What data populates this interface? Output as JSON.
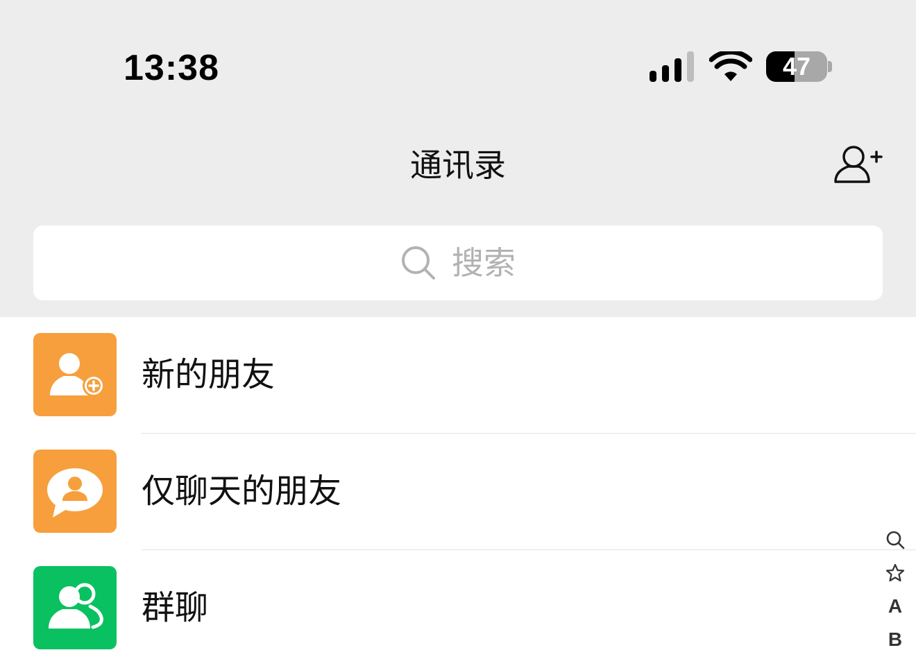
{
  "status_bar": {
    "time": "13:38",
    "battery_level": "47",
    "battery_fraction": 0.47,
    "signal_icon": "cellular-signal-icon",
    "wifi_icon": "wifi-icon"
  },
  "header": {
    "title": "通讯录",
    "add_contact_icon": "add-contact-icon"
  },
  "search": {
    "placeholder": "搜索",
    "icon": "search-icon"
  },
  "contacts_menu": [
    {
      "label": "新的朋友",
      "icon": "new-friend-icon",
      "color": "#f79f3d"
    },
    {
      "label": "仅聊天的朋友",
      "icon": "chat-only-friend-icon",
      "color": "#f79f3d"
    },
    {
      "label": "群聊",
      "icon": "group-chat-icon",
      "color": "#09c160"
    }
  ],
  "index_bar": {
    "items": [
      "search-icon",
      "star-icon",
      "A",
      "B"
    ]
  },
  "colors": {
    "header_background": "#ededed",
    "list_background": "#ffffff",
    "orange_accent": "#f79f3d",
    "green_accent": "#09c160"
  }
}
